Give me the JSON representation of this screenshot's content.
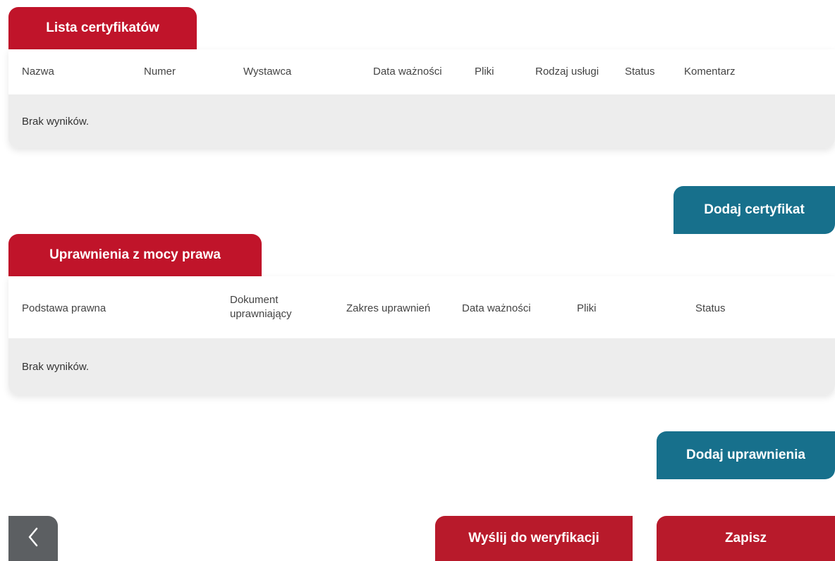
{
  "certificates": {
    "tab_label": "Lista certyfikatów",
    "columns": [
      "Nazwa",
      "Numer",
      "Wystawca",
      "Data ważności",
      "Pliki",
      "Rodzaj usługi",
      "Status",
      "Komentarz"
    ],
    "empty_text": "Brak wyników.",
    "add_button": "Dodaj certyfikat"
  },
  "entitlements": {
    "tab_label": "Uprawnienia z mocy prawa",
    "columns": [
      "Podstawa prawna",
      "Dokument uprawniający",
      "Zakres uprawnień",
      "Data ważności",
      "Pliki",
      "Status"
    ],
    "empty_text": "Brak wyników.",
    "add_button": "Dodaj uprawnienia"
  },
  "footer": {
    "back_icon": "chevron-left-icon",
    "send_button": "Wyślij do weryfikacji",
    "save_button": "Zapisz"
  },
  "colors": {
    "primary_red": "#c0142a",
    "action_blue": "#17708c",
    "back_gray": "#5c5f62",
    "empty_row_bg": "#ededed"
  }
}
